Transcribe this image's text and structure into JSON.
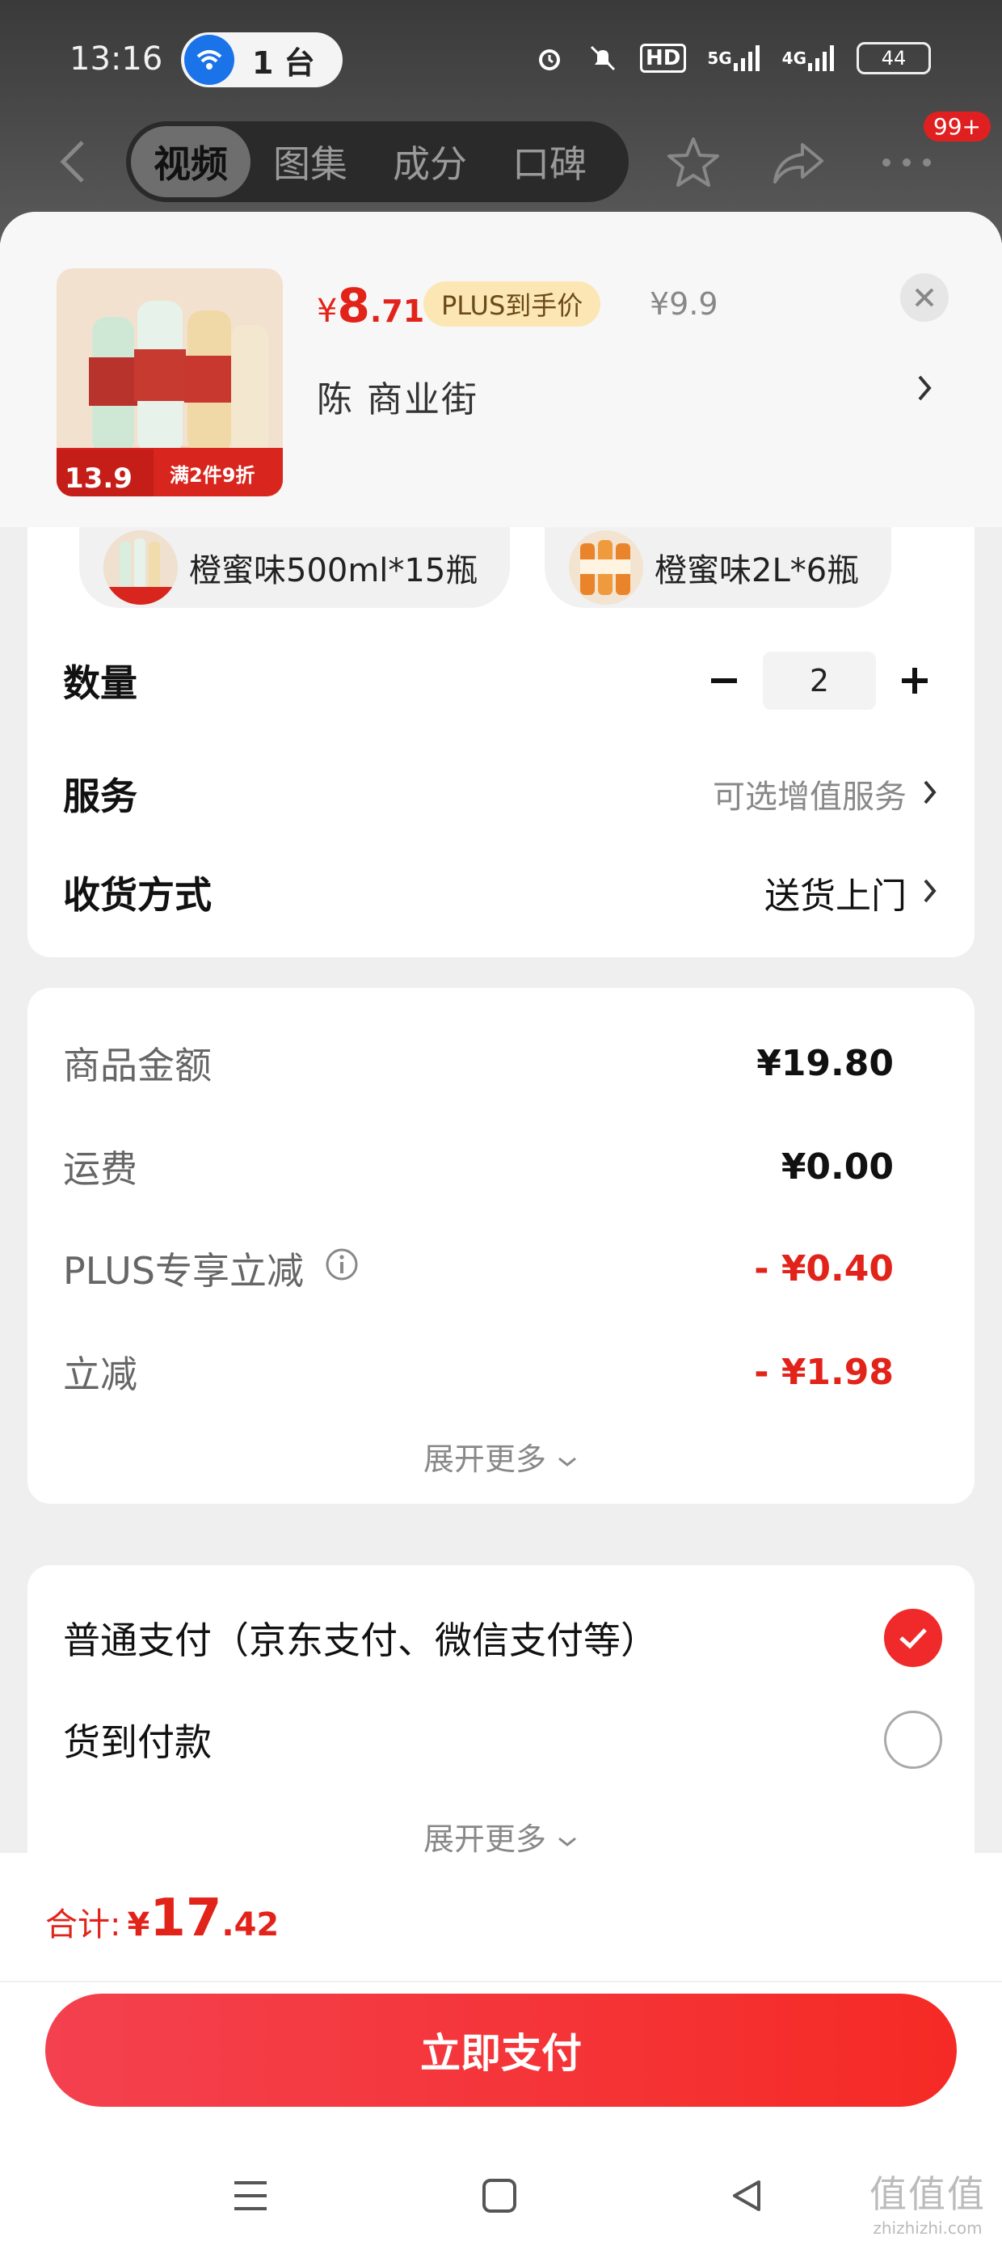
{
  "status_bar": {
    "time": "13:16",
    "device_pill": "1 台",
    "hd_label": "HD",
    "net1": "5G",
    "net2": "4G",
    "battery": "44"
  },
  "nav": {
    "tabs": [
      "视频",
      "图集",
      "成分",
      "口碑"
    ],
    "active_tab": "视频",
    "badge": "99+"
  },
  "product": {
    "price_currency": "¥",
    "price_int": "8",
    "price_dec": ".71",
    "plus_tag": "PLUS到手价",
    "original_price": "¥9.9",
    "shop_name": "陈  商业街",
    "thumb_badge_price": "13.9",
    "thumb_badge_text": "满2件9折"
  },
  "variants": [
    {
      "label": "橙蜜味500ml*15瓶"
    },
    {
      "label": "橙蜜味2L*6瓶"
    }
  ],
  "options": {
    "quantity_label": "数量",
    "quantity_value": "2",
    "service_label": "服务",
    "service_value": "可选增值服务",
    "delivery_label": "收货方式",
    "delivery_value": "送货上门"
  },
  "amounts": {
    "rows": [
      {
        "label": "商品金额",
        "value": "¥19.80"
      },
      {
        "label": "运费",
        "value": "¥0.00"
      },
      {
        "label": "PLUS专享立减",
        "value": "- ¥0.40"
      },
      {
        "label": "立减",
        "value": "- ¥1.98"
      }
    ],
    "expand_label": "展开更多"
  },
  "payment": {
    "methods": [
      {
        "label": "普通支付（京东支付、微信支付等）",
        "selected": true
      },
      {
        "label": "货到付款",
        "selected": false
      }
    ],
    "expand_label": "展开更多"
  },
  "footer": {
    "total_label": "合计:",
    "total_currency": "¥",
    "total_int": "17",
    "total_dec": ".42",
    "pay_button": "立即支付"
  },
  "watermark": {
    "line1": "值值值",
    "line2": "zhizhizhi.com"
  },
  "colors": {
    "accent_red": "#e2231a",
    "plus_tag_bg": "#fbe6b4"
  }
}
